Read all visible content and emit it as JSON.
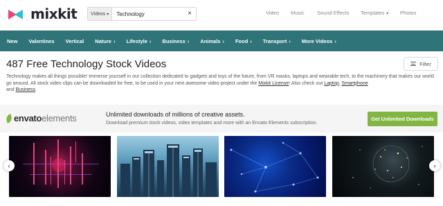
{
  "logo": {
    "text": "mixkit",
    "icon": "mixkit-logo-mark"
  },
  "search": {
    "category": "Videos",
    "value": "Technology",
    "clear_icon": "close-icon"
  },
  "topnav": {
    "video": "Video",
    "music": "Music",
    "sfx": "Sound Effects",
    "templates": "Templates",
    "photos": "Photos"
  },
  "categories": [
    "New",
    "Valentines",
    "Vertical",
    "Nature",
    "Lifestyle",
    "Business",
    "Animals",
    "Food",
    "Transport",
    "More Videos"
  ],
  "category_has_chevron": [
    false,
    false,
    false,
    true,
    true,
    true,
    true,
    true,
    true,
    true
  ],
  "page": {
    "title": "487 Free Technology Stock Videos",
    "filter_label": "Filter",
    "desc_part1": "Technology makes all things possible! Immerse yourself in our collection dedicated to gadgets and toys of the future, from VR masks, laptops and wearable tech, to the machinery that makes our world go around. All stock video clips can be downloaded for free, to be used in your next awesome video project under the ",
    "license_link": "Mixkit License",
    "desc_part2": "! Also check out ",
    "laptop_link": "Laptop",
    "comma": ", ",
    "smartphone_link": "Smartphone",
    "and": " and ",
    "business_link": "Business",
    "period": "."
  },
  "envato": {
    "logo_bold": "envato",
    "logo_light": "elements",
    "headline": "Unlimited downloads of millions of creative assets.",
    "subline": "Download premium stock videos, video templates and more with an Envato Elements subscription.",
    "cta": "Get Unlimited Downloads",
    "accent": "#82b541"
  },
  "colors": {
    "category_bar": "#2f7478",
    "logo_pink": "#e64575",
    "logo_cyan": "#2fbfd3"
  },
  "arrows": {
    "left": "‹",
    "right": "›"
  }
}
